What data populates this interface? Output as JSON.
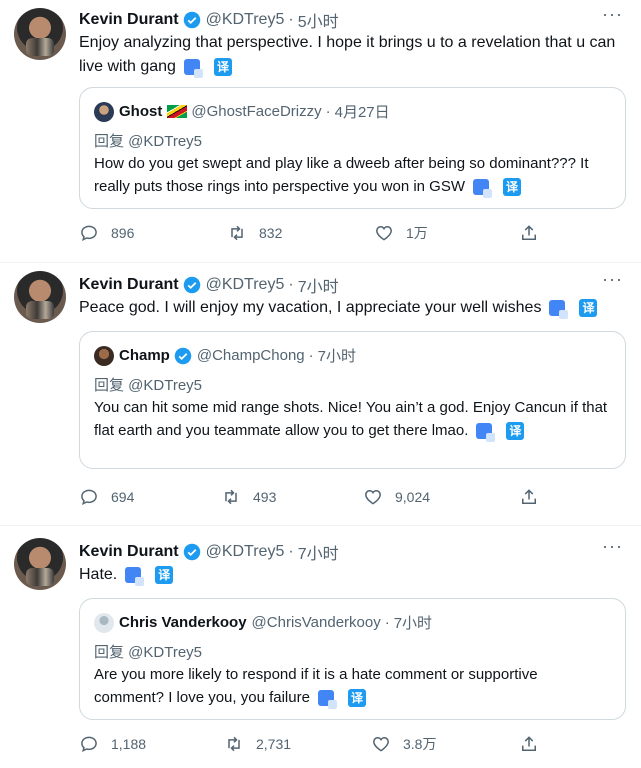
{
  "tweets": [
    {
      "author": "Kevin Durant",
      "handle": "@KDTrey5",
      "time": "5小时",
      "text": "Enjoy analyzing that perspective. I hope it brings u to a revelation that u can live with gang",
      "quote": {
        "author": "Ghost",
        "handle": "@GhostFaceDrizzy",
        "time": "4月27日",
        "reply": "回复 @KDTrey5",
        "text": "How do you get swept and play like a dweeb after being so dominant??? It really puts those rings into perspective you won in GSW"
      },
      "replies": "896",
      "retweets": "832",
      "likes": "1万"
    },
    {
      "author": "Kevin Durant",
      "handle": "@KDTrey5",
      "time": "7小时",
      "text": "Peace god. I will enjoy my vacation, I appreciate your well wishes",
      "quote": {
        "author": "Champ",
        "handle": "@ChampChong",
        "time": "7小时",
        "reply": "回复 @KDTrey5",
        "text": "You can hit some mid range shots. Nice! You ain’t a god. Enjoy Cancun if that flat earth and you teammate allow you to get there lmao."
      },
      "replies": "694",
      "retweets": "493",
      "likes": "9,024"
    },
    {
      "author": "Kevin Durant",
      "handle": "@KDTrey5",
      "time": "7小时",
      "text": "Hate.",
      "quote": {
        "author": "Chris Vanderkooy",
        "handle": "@ChrisVanderkooy",
        "time": "7小时",
        "reply": "回复 @KDTrey5",
        "text": "Are you more likely to respond if it is a hate comment or supportive comment? I love you, you failure"
      },
      "replies": "1,188",
      "retweets": "2,731",
      "likes": "3.8万"
    }
  ],
  "ui": {
    "translate_label": "译",
    "more_label": "···",
    "separator": "·"
  },
  "colors": {
    "accent": "#1d9bf0",
    "muted": "#536471",
    "border": "#cfd9de"
  },
  "icons": [
    "verified-badge-icon",
    "google-translate-icon",
    "translate-icon",
    "reply-icon",
    "retweet-icon",
    "like-icon",
    "share-icon",
    "more-icon"
  ]
}
